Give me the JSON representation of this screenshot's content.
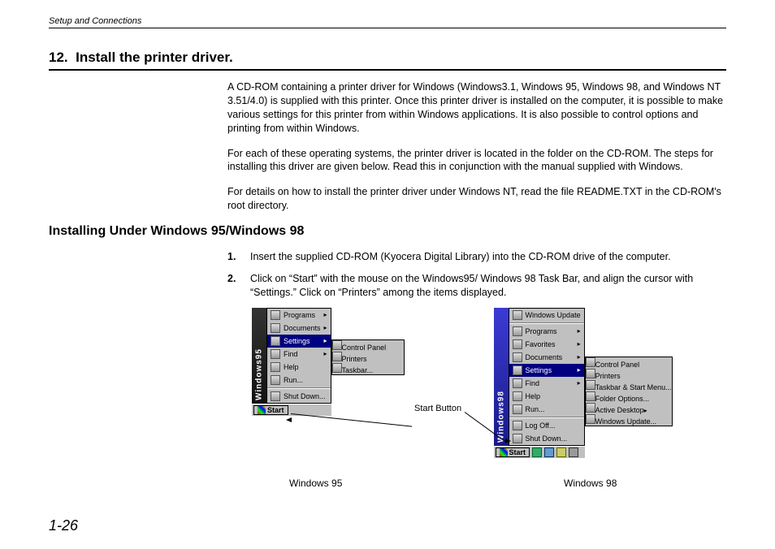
{
  "header": {
    "running": "Setup and Connections"
  },
  "section": {
    "number": "12.",
    "title": "Install the printer driver."
  },
  "paragraphs": {
    "p1": "A CD-ROM containing a printer driver for Windows (Windows3.1, Windows 95, Windows 98, and Windows NT 3.51/4.0) is supplied with this printer.  Once this printer driver is installed on the computer, it is possible to make various settings for this printer from within Windows applications.  It is also possible to control options and printing from within Windows.",
    "p2": "For each of these operating systems, the printer driver is located in the folder on the CD-ROM.  The steps for installing this driver are given below.  Read this in conjunction with the manual supplied with Windows.",
    "p3": "For details on how to install the printer driver under Windows NT, read the file README.TXT in the CD-ROM's root directory."
  },
  "subsection": {
    "title": "Installing Under Windows 95/Windows 98"
  },
  "steps": {
    "s1": "Insert the supplied CD-ROM (Kyocera Digital Library) into the CD-ROM drive of the computer.",
    "s2": "Click on “Start” with the mouse on the Windows95/ Windows 98 Task Bar, and align the cursor with “Settings.” Click on “Printers” among the items displayed."
  },
  "win95": {
    "brand": "Windows95",
    "menu": [
      "Programs",
      "Documents",
      "Settings",
      "Find",
      "Help",
      "Run...",
      "Shut Down..."
    ],
    "submenu": [
      "Control Panel",
      "Printers",
      "Taskbar..."
    ],
    "start": "Start",
    "caption": "Windows 95"
  },
  "win98": {
    "brand": "Windows98",
    "top": "Windows Update",
    "menu": [
      "Programs",
      "Favorites",
      "Documents",
      "Settings",
      "Find",
      "Help",
      "Run...",
      "Log Off...",
      "Shut Down..."
    ],
    "submenu": [
      "Control Panel",
      "Printers",
      "Taskbar & Start Menu...",
      "Folder Options...",
      "Active Desktop",
      "Windows Update..."
    ],
    "start": "Start",
    "caption": "Windows 98"
  },
  "annotation": {
    "start_button": "Start Button"
  },
  "page_number": "1-26"
}
